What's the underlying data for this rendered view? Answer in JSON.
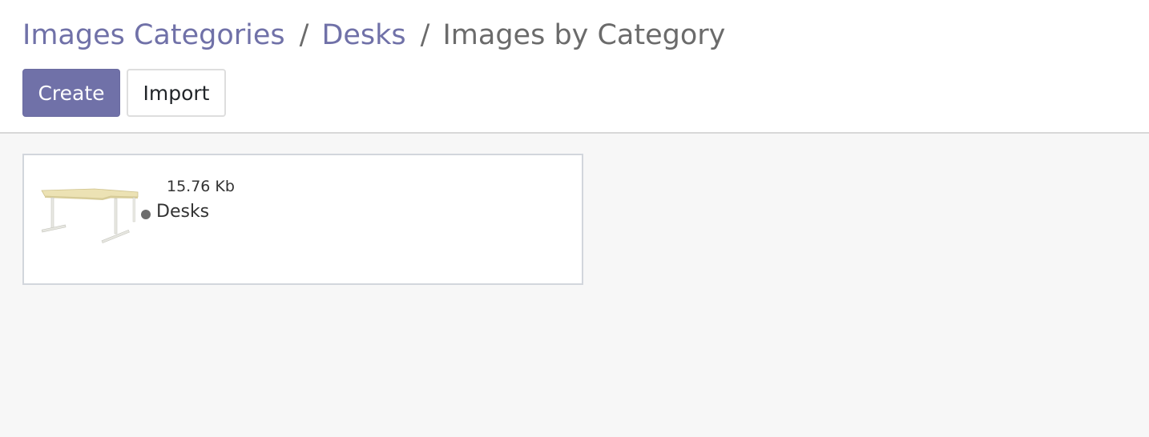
{
  "breadcrumb": {
    "items": [
      {
        "label": "Images Categories"
      },
      {
        "label": "Desks"
      }
    ],
    "separator": "/",
    "current": "Images by Category"
  },
  "toolbar": {
    "create_label": "Create",
    "import_label": "Import"
  },
  "kanban": {
    "records": [
      {
        "file_size": "15.76 Kb",
        "category": "Desks",
        "thumbnail_icon": "desk-image"
      }
    ]
  },
  "colors": {
    "accent": "#7071a8",
    "background": "#f7f7f7",
    "status_dot": "#6c6c6c"
  }
}
